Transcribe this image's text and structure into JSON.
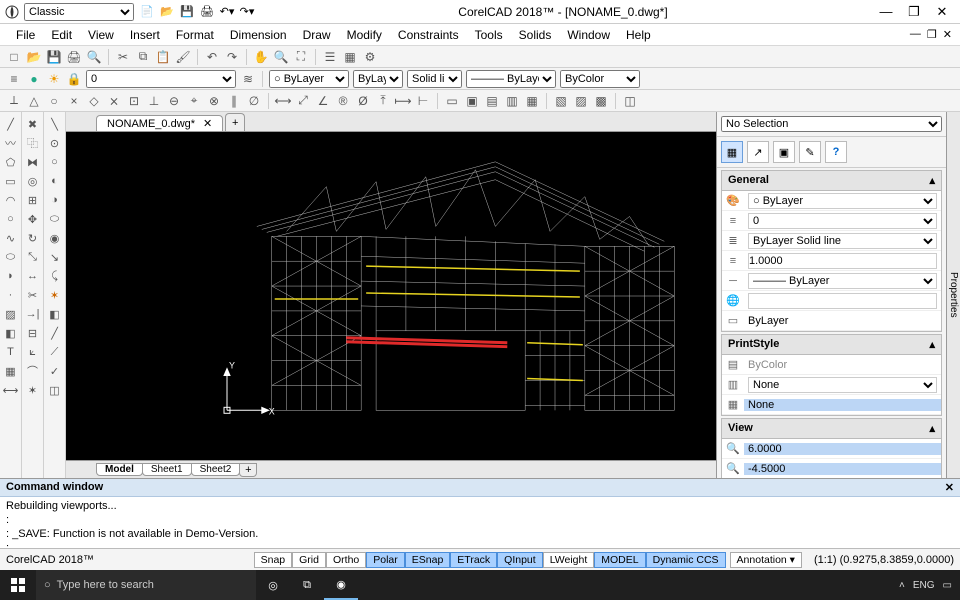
{
  "titlebar": {
    "workspace": "Classic",
    "app_title": "CorelCAD 2018™ - [NONAME_0.dwg*]"
  },
  "menus": [
    "File",
    "Edit",
    "View",
    "Insert",
    "Format",
    "Dimension",
    "Draw",
    "Modify",
    "Constraints",
    "Tools",
    "Solids",
    "Window",
    "Help"
  ],
  "layerbar": {
    "layer": "0",
    "color": "○ ByLayer",
    "linetype": "ByLayer",
    "linestyle": "Solid line",
    "bylayer2": "ByLayer",
    "bycolor": "ByColor"
  },
  "doc_tab": "NONAME_0.dwg*",
  "sheet_tabs": [
    "Model",
    "Sheet1",
    "Sheet2"
  ],
  "properties": {
    "selection": "No Selection",
    "sections": {
      "general": {
        "title": "General",
        "color": "○ ByLayer",
        "layer": "0",
        "linetype": "ByLayer",
        "linestyle2": "Solid line",
        "lineweight": "1.0000",
        "bylayer3": "ByLayer",
        "bylayer4": "ByLayer"
      },
      "printstyle": {
        "title": "PrintStyle",
        "bycolor": "ByColor",
        "none1": "None",
        "none2": "None"
      },
      "view": {
        "title": "View",
        "val1": "6.0000",
        "val2": "-4.5000"
      }
    },
    "side_label": "Properties"
  },
  "command": {
    "title": "Command window",
    "lines": [
      "Rebuilding viewports...",
      ":",
      ": _SAVE: Function is not available in Demo-Version.",
      ":"
    ]
  },
  "status": {
    "appname": "CorelCAD 2018™",
    "buttons": [
      {
        "label": "Snap",
        "on": false
      },
      {
        "label": "Grid",
        "on": false
      },
      {
        "label": "Ortho",
        "on": false
      },
      {
        "label": "Polar",
        "on": true
      },
      {
        "label": "ESnap",
        "on": true
      },
      {
        "label": "ETrack",
        "on": true
      },
      {
        "label": "QInput",
        "on": true
      },
      {
        "label": "LWeight",
        "on": false
      },
      {
        "label": "MODEL",
        "on": true
      },
      {
        "label": "Dynamic CCS",
        "on": true
      }
    ],
    "annotation_label": "Annotation ▾",
    "coords": "(1:1)   (0.9275,8.3859,0.0000)"
  },
  "taskbar": {
    "search_placeholder": "Type here to search",
    "time": "",
    "lang": "ENG"
  },
  "axis_labels": {
    "y": "Y",
    "x": "X"
  },
  "colors": {
    "scaffold_main": "#cccccc",
    "scaffold_yellow": "#e7d420",
    "scaffold_red": "#e02a2a",
    "canvas_bg": "#000000"
  }
}
